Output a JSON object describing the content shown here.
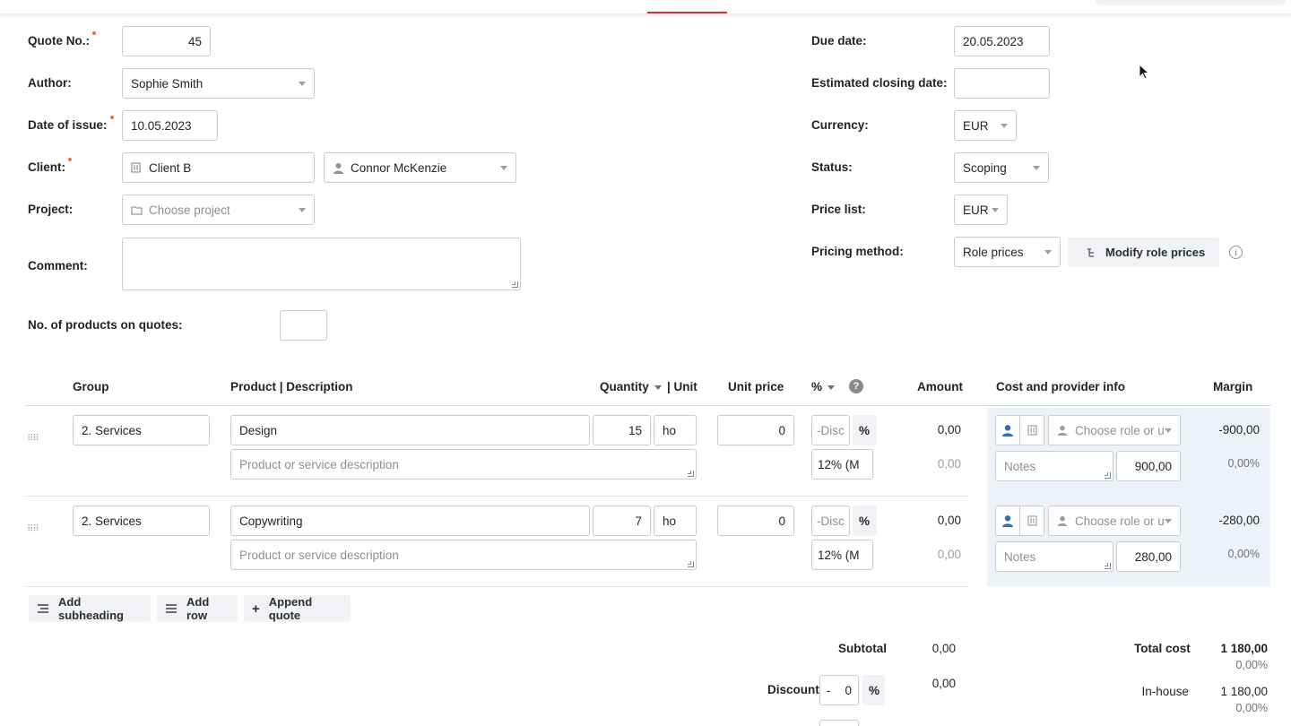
{
  "form": {
    "quote_no": {
      "label": "Quote No.:",
      "value": "45"
    },
    "author": {
      "label": "Author:",
      "value": "Sophie Smith"
    },
    "date_of_issue": {
      "label": "Date of issue:",
      "value": "10.05.2023"
    },
    "client": {
      "label": "Client:",
      "value": "Client B",
      "contact": "Connor McKenzie"
    },
    "project": {
      "label": "Project:",
      "placeholder": "Choose project"
    },
    "comment": {
      "label": "Comment:",
      "value": ""
    },
    "products_on_quotes": {
      "label": "No. of products on quotes:",
      "value": ""
    },
    "due_date": {
      "label": "Due date:",
      "value": "20.05.2023"
    },
    "estimated_closing_date": {
      "label": "Estimated closing date:",
      "value": ""
    },
    "currency": {
      "label": "Currency:",
      "value": "EUR"
    },
    "status": {
      "label": "Status:",
      "value": "Scoping"
    },
    "price_list": {
      "label": "Price list:",
      "value": "EUR"
    },
    "pricing_method": {
      "label": "Pricing method:",
      "value": "Role prices",
      "modify_button": "Modify role prices"
    }
  },
  "table": {
    "headers": {
      "group": "Group",
      "product": "Product | Description",
      "quantity": "Quantity",
      "unit": "| Unit",
      "unit_price": "Unit price",
      "percent": "%",
      "amount": "Amount",
      "cost_info": "Cost and provider info",
      "margin": "Margin"
    },
    "rows": [
      {
        "group": "2. Services",
        "product": "Design",
        "description_placeholder": "Product or service description",
        "quantity": "15",
        "unit": "ho",
        "unit_price": "0",
        "discount_placeholder": "-Disc",
        "discount_unit": "%",
        "vat": "12% (M",
        "amount": "0,00",
        "amount_vat": "0,00",
        "role_placeholder": "Choose role or u",
        "notes_placeholder": "Notes",
        "cost": "900,00",
        "margin": "-900,00",
        "margin_pct": "0,00%"
      },
      {
        "group": "2. Services",
        "product": "Copywriting",
        "description_placeholder": "Product or service description",
        "quantity": "7",
        "unit": "ho",
        "unit_price": "0",
        "discount_placeholder": "-Disc",
        "discount_unit": "%",
        "vat": "12% (M",
        "amount": "0,00",
        "amount_vat": "0,00",
        "role_placeholder": "Choose role or u",
        "notes_placeholder": "Notes",
        "cost": "280,00",
        "margin": "-280,00",
        "margin_pct": "0,00%"
      }
    ]
  },
  "actions": {
    "add_subheading": "Add subheading",
    "add_row": "Add row",
    "append_quote": "Append quote"
  },
  "totals": {
    "subtotal_label": "Subtotal",
    "subtotal_value": "0,00",
    "discount_label": "Discount",
    "discount_sign": "-",
    "discount_value": "0",
    "discount_unit": "%",
    "discount_amount": "0,00",
    "total_cost_label": "Total cost",
    "total_cost_value": "1 180,00",
    "total_cost_pct": "0,00%",
    "inhouse_label": "In-house",
    "inhouse_value": "1 180,00",
    "inhouse_pct": "0,00%"
  },
  "colors": {
    "accent_red": "#c7383c",
    "required_dot": "#e8712f",
    "person_icon_blue": "#2f6fb6",
    "panel_bg": "#edf2f8"
  }
}
